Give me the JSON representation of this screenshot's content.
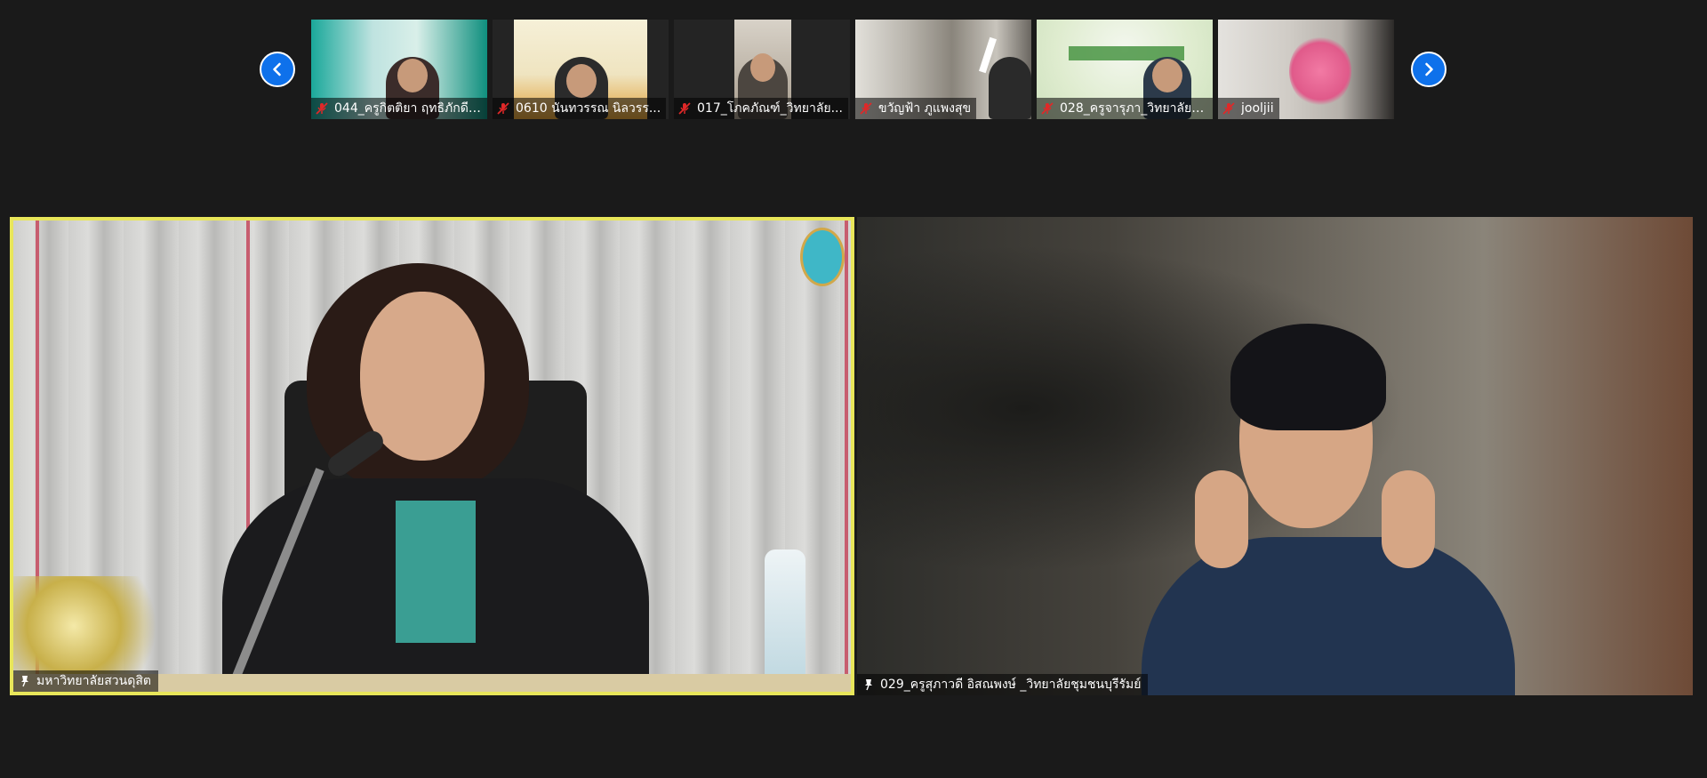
{
  "thumbnail_strip": {
    "prev_icon": "chevron-left-icon",
    "next_icon": "chevron-right-icon",
    "participants": [
      {
        "name": "044_ครูกิตติยา ฤทธิภักดี_...",
        "muted": true
      },
      {
        "name": "0610 นันทวรรณ นิลวรร...",
        "muted": true
      },
      {
        "name": "017_โภคภัณฑ์_วิทยาลัย...",
        "muted": true
      },
      {
        "name": "ขวัญฟ้า ภูแพงสุข",
        "muted": true
      },
      {
        "name": "028_ครูจารุภา_วิทยาลัยชุ...",
        "muted": true
      },
      {
        "name": "jooljii",
        "muted": true
      }
    ]
  },
  "main_tiles": {
    "left": {
      "name": "มหาวิทยาลัยสวนดุสิต",
      "pinned": true,
      "active_speaker": true
    },
    "right": {
      "name": "029_ครูสุภาวดี อิสณพงษ์ _วิทยาลัยชุมชนบุรีรัมย์",
      "pinned": true
    }
  },
  "colors": {
    "background": "#1a1a1a",
    "nav_button": "#0e71eb",
    "active_speaker_border": "#e8e65a",
    "muted_icon": "#e02828"
  }
}
